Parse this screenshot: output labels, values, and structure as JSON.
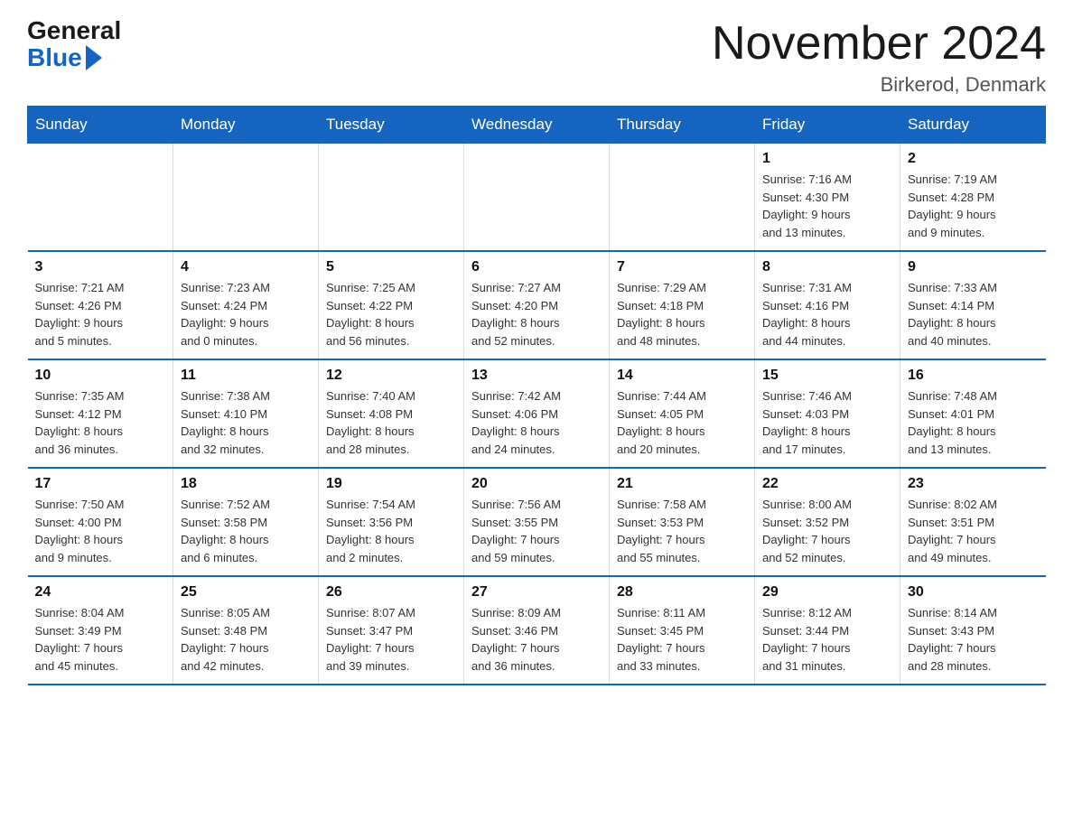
{
  "logo": {
    "general": "General",
    "blue": "Blue"
  },
  "header": {
    "title": "November 2024",
    "location": "Birkerod, Denmark"
  },
  "weekdays": [
    "Sunday",
    "Monday",
    "Tuesday",
    "Wednesday",
    "Thursday",
    "Friday",
    "Saturday"
  ],
  "weeks": [
    [
      {
        "day": "",
        "info": ""
      },
      {
        "day": "",
        "info": ""
      },
      {
        "day": "",
        "info": ""
      },
      {
        "day": "",
        "info": ""
      },
      {
        "day": "",
        "info": ""
      },
      {
        "day": "1",
        "info": "Sunrise: 7:16 AM\nSunset: 4:30 PM\nDaylight: 9 hours\nand 13 minutes."
      },
      {
        "day": "2",
        "info": "Sunrise: 7:19 AM\nSunset: 4:28 PM\nDaylight: 9 hours\nand 9 minutes."
      }
    ],
    [
      {
        "day": "3",
        "info": "Sunrise: 7:21 AM\nSunset: 4:26 PM\nDaylight: 9 hours\nand 5 minutes."
      },
      {
        "day": "4",
        "info": "Sunrise: 7:23 AM\nSunset: 4:24 PM\nDaylight: 9 hours\nand 0 minutes."
      },
      {
        "day": "5",
        "info": "Sunrise: 7:25 AM\nSunset: 4:22 PM\nDaylight: 8 hours\nand 56 minutes."
      },
      {
        "day": "6",
        "info": "Sunrise: 7:27 AM\nSunset: 4:20 PM\nDaylight: 8 hours\nand 52 minutes."
      },
      {
        "day": "7",
        "info": "Sunrise: 7:29 AM\nSunset: 4:18 PM\nDaylight: 8 hours\nand 48 minutes."
      },
      {
        "day": "8",
        "info": "Sunrise: 7:31 AM\nSunset: 4:16 PM\nDaylight: 8 hours\nand 44 minutes."
      },
      {
        "day": "9",
        "info": "Sunrise: 7:33 AM\nSunset: 4:14 PM\nDaylight: 8 hours\nand 40 minutes."
      }
    ],
    [
      {
        "day": "10",
        "info": "Sunrise: 7:35 AM\nSunset: 4:12 PM\nDaylight: 8 hours\nand 36 minutes."
      },
      {
        "day": "11",
        "info": "Sunrise: 7:38 AM\nSunset: 4:10 PM\nDaylight: 8 hours\nand 32 minutes."
      },
      {
        "day": "12",
        "info": "Sunrise: 7:40 AM\nSunset: 4:08 PM\nDaylight: 8 hours\nand 28 minutes."
      },
      {
        "day": "13",
        "info": "Sunrise: 7:42 AM\nSunset: 4:06 PM\nDaylight: 8 hours\nand 24 minutes."
      },
      {
        "day": "14",
        "info": "Sunrise: 7:44 AM\nSunset: 4:05 PM\nDaylight: 8 hours\nand 20 minutes."
      },
      {
        "day": "15",
        "info": "Sunrise: 7:46 AM\nSunset: 4:03 PM\nDaylight: 8 hours\nand 17 minutes."
      },
      {
        "day": "16",
        "info": "Sunrise: 7:48 AM\nSunset: 4:01 PM\nDaylight: 8 hours\nand 13 minutes."
      }
    ],
    [
      {
        "day": "17",
        "info": "Sunrise: 7:50 AM\nSunset: 4:00 PM\nDaylight: 8 hours\nand 9 minutes."
      },
      {
        "day": "18",
        "info": "Sunrise: 7:52 AM\nSunset: 3:58 PM\nDaylight: 8 hours\nand 6 minutes."
      },
      {
        "day": "19",
        "info": "Sunrise: 7:54 AM\nSunset: 3:56 PM\nDaylight: 8 hours\nand 2 minutes."
      },
      {
        "day": "20",
        "info": "Sunrise: 7:56 AM\nSunset: 3:55 PM\nDaylight: 7 hours\nand 59 minutes."
      },
      {
        "day": "21",
        "info": "Sunrise: 7:58 AM\nSunset: 3:53 PM\nDaylight: 7 hours\nand 55 minutes."
      },
      {
        "day": "22",
        "info": "Sunrise: 8:00 AM\nSunset: 3:52 PM\nDaylight: 7 hours\nand 52 minutes."
      },
      {
        "day": "23",
        "info": "Sunrise: 8:02 AM\nSunset: 3:51 PM\nDaylight: 7 hours\nand 49 minutes."
      }
    ],
    [
      {
        "day": "24",
        "info": "Sunrise: 8:04 AM\nSunset: 3:49 PM\nDaylight: 7 hours\nand 45 minutes."
      },
      {
        "day": "25",
        "info": "Sunrise: 8:05 AM\nSunset: 3:48 PM\nDaylight: 7 hours\nand 42 minutes."
      },
      {
        "day": "26",
        "info": "Sunrise: 8:07 AM\nSunset: 3:47 PM\nDaylight: 7 hours\nand 39 minutes."
      },
      {
        "day": "27",
        "info": "Sunrise: 8:09 AM\nSunset: 3:46 PM\nDaylight: 7 hours\nand 36 minutes."
      },
      {
        "day": "28",
        "info": "Sunrise: 8:11 AM\nSunset: 3:45 PM\nDaylight: 7 hours\nand 33 minutes."
      },
      {
        "day": "29",
        "info": "Sunrise: 8:12 AM\nSunset: 3:44 PM\nDaylight: 7 hours\nand 31 minutes."
      },
      {
        "day": "30",
        "info": "Sunrise: 8:14 AM\nSunset: 3:43 PM\nDaylight: 7 hours\nand 28 minutes."
      }
    ]
  ]
}
